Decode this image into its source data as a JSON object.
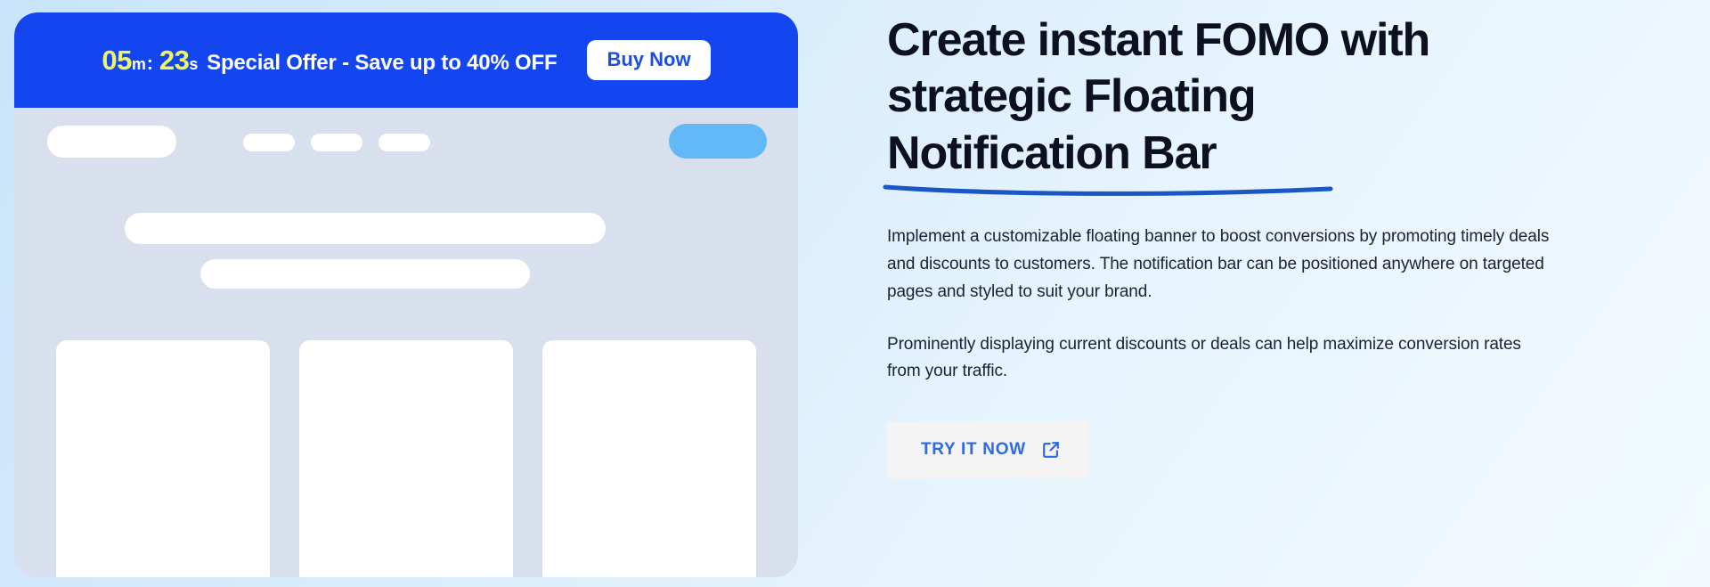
{
  "theme": {
    "page_background_start": "#c9e4fa",
    "page_background_end": "#f2fafe",
    "notification_bar_blue": "#1446f0",
    "timer_yellow": "#eef566",
    "accent_blue": "#2b6ae8",
    "underline_blue": "#1a56c4",
    "mockup_panel_gray": "#d7e0ec",
    "mockup_cta_blue": "#63b8f7"
  },
  "mockup": {
    "name": "floating-notification-bar-preview",
    "notification_bar": {
      "timer": {
        "minutes": "05",
        "minutes_unit": "m",
        "separator": ":",
        "seconds": "23",
        "seconds_unit": "s"
      },
      "message": "Special Offer - Save up to 40% OFF",
      "button_label": "Buy Now"
    },
    "skeleton": {
      "logo": "site-logo-placeholder",
      "nav_links": [
        "nav-link-placeholder-1",
        "nav-link-placeholder-2",
        "nav-link-placeholder-3"
      ],
      "nav_cta": "nav-cta-placeholder",
      "hero_lines": [
        "hero-heading-placeholder",
        "hero-subheading-placeholder"
      ],
      "cards": [
        "content-card-placeholder-1",
        "content-card-placeholder-2",
        "content-card-placeholder-3"
      ]
    }
  },
  "content": {
    "headline_line1": "Create instant FOMO with",
    "headline_line2": "strategic Floating",
    "headline_line3": "Notification Bar",
    "paragraph1": "Implement a customizable floating banner to boost conversions by promoting timely deals and discounts to customers. The notification bar can be positioned anywhere on targeted pages and styled to suit your brand.",
    "paragraph2": "Prominently displaying current discounts or deals can help maximize conversion rates from your traffic.",
    "cta_label": "TRY IT NOW",
    "cta_icon": "external-link-icon"
  }
}
